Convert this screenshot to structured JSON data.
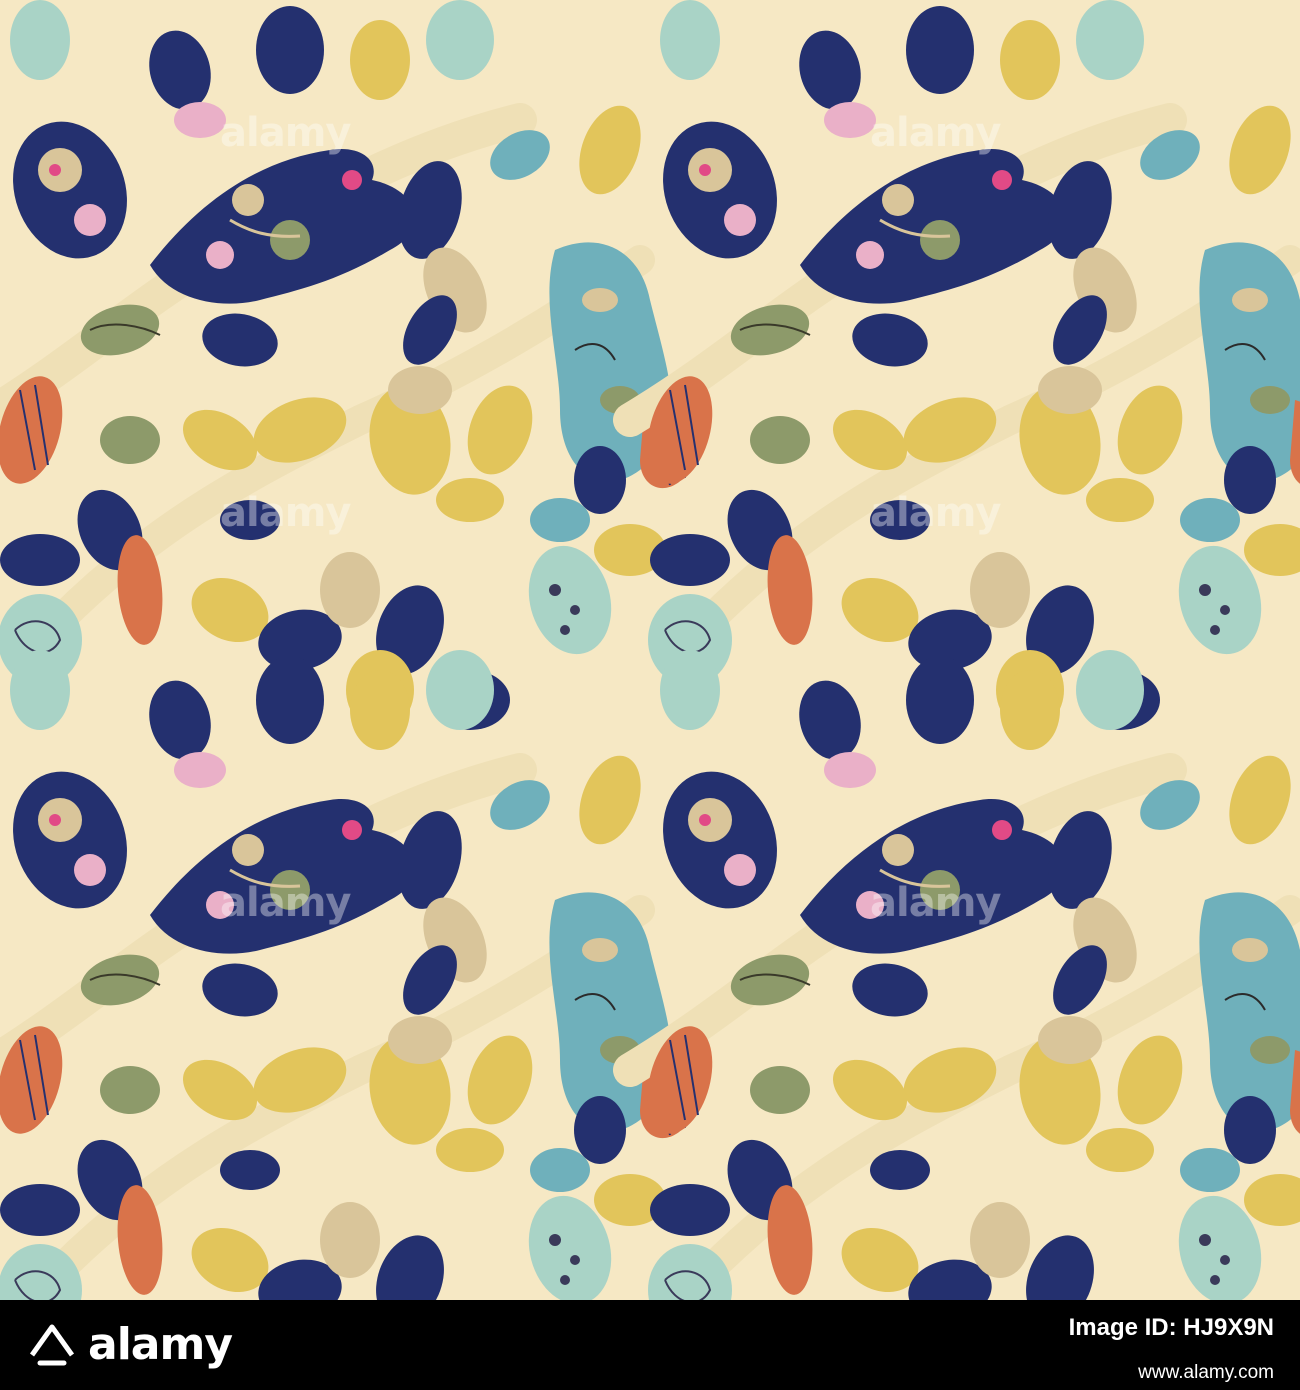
{
  "image": {
    "description_tile": "seamless bird and leaf pattern",
    "background_color": "#f6e8c4",
    "palette": {
      "cream": "#f6e8c4",
      "navy": "#24306f",
      "teal": "#6fb0bb",
      "mint": "#a9d3c6",
      "mustard": "#e2c55b",
      "sand": "#d9c59a",
      "olive": "#8d9a6a",
      "orange": "#d9734a",
      "pink": "#eab0c8",
      "magenta": "#e14a86"
    }
  },
  "watermark": {
    "text": "alamy"
  },
  "footer": {
    "logo_icon": "alamy-logo-icon",
    "logo_text": "alamy",
    "image_id_label": "Image ID: HJ9X9N",
    "url": "www.alamy.com"
  }
}
